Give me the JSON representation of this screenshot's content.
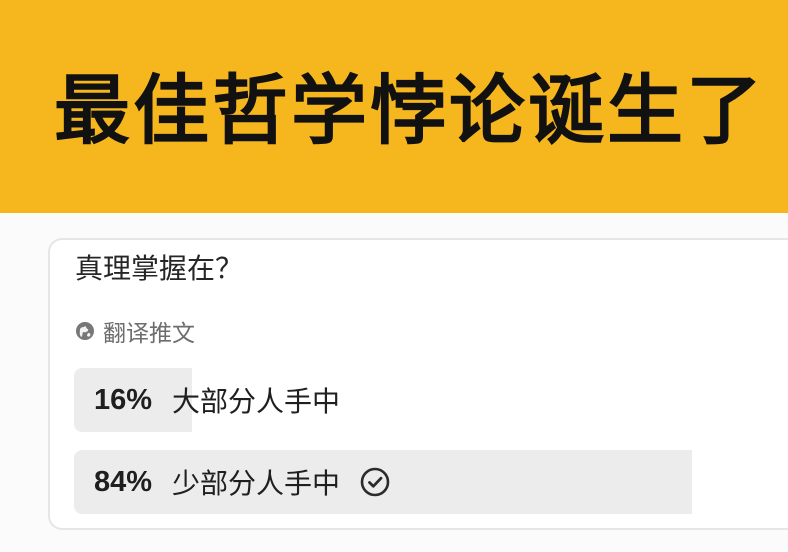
{
  "banner": {
    "title": "最佳哲学悖论诞生了",
    "background_color": "#f6b61d"
  },
  "poll": {
    "question": "真理掌握在？",
    "translate_label": "翻译推文",
    "translate_icon": "globe-icon",
    "options": [
      {
        "percent_label": "16%",
        "percent_value": 16,
        "label": "大部分人手中",
        "selected": false
      },
      {
        "percent_label": "84%",
        "percent_value": 84,
        "label": "少部分人手中",
        "selected": true,
        "selected_icon": "check-circle-icon"
      }
    ],
    "fill_color": "#ececec"
  }
}
